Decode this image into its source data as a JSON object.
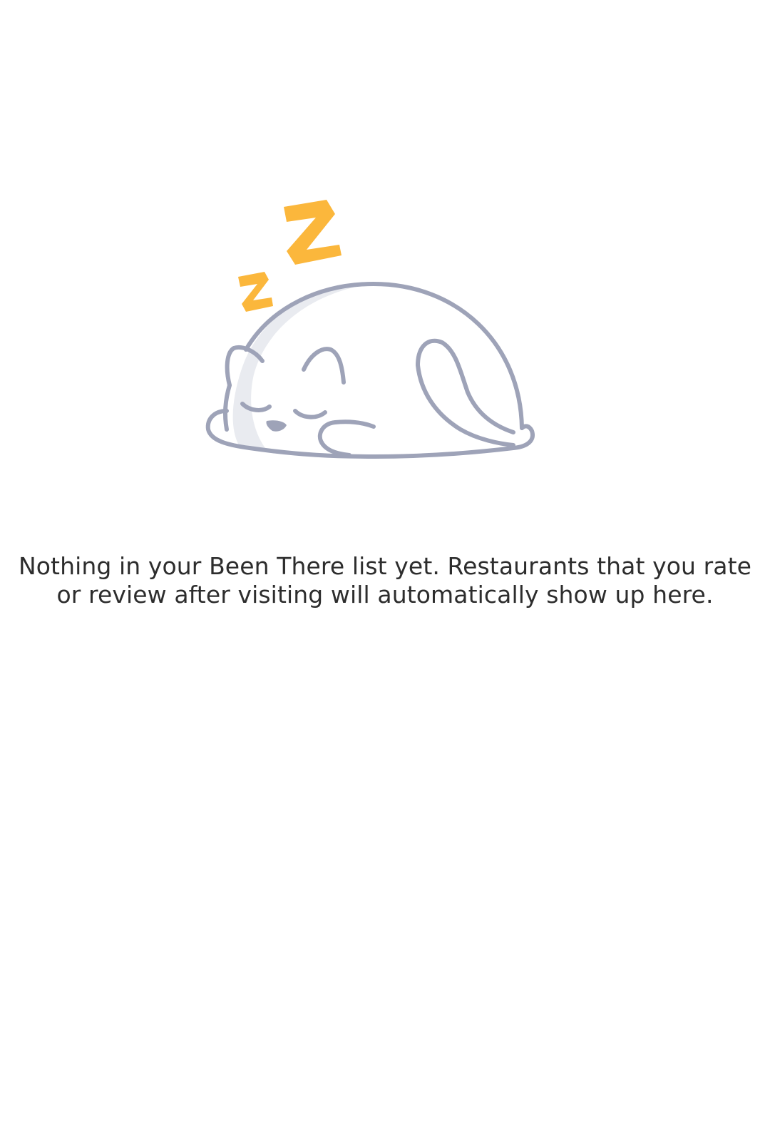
{
  "empty_state": {
    "illustration": "sleeping-cat-illustration",
    "message": "Nothing in your Been There list yet. Restaurants that you rate or review after visiting will automatically show up here."
  },
  "colors": {
    "background": "#ffffff",
    "outline": "#9ea3b8",
    "shadow_fill": "#e9ebf0",
    "zzz_accent": "#fbb73c",
    "text": "#2d2d2d"
  }
}
